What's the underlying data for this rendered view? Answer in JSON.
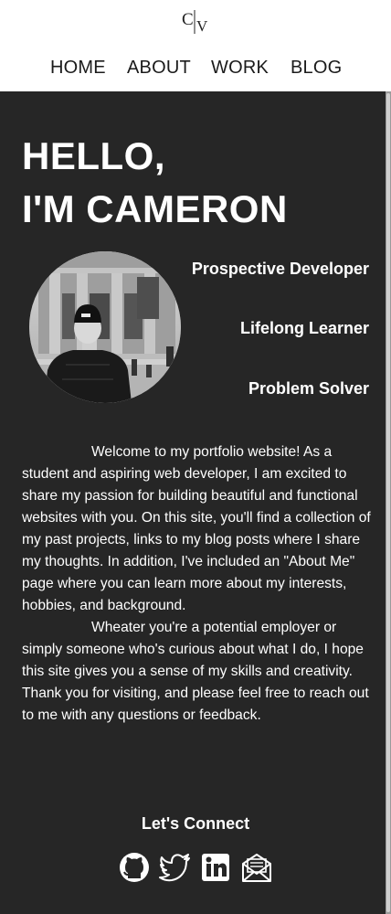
{
  "header": {
    "logo_letters": "CV",
    "nav": [
      {
        "label": "HOME"
      },
      {
        "label": "ABOUT"
      },
      {
        "label": "WORK"
      },
      {
        "label": "BLOG"
      }
    ]
  },
  "hero": {
    "title_line1": "HELLO,",
    "title_line2": "I'M CAMERON",
    "traits": [
      "Prospective Developer",
      "Lifelong Learner",
      "Problem Solver"
    ]
  },
  "intro": {
    "paragraphs": [
      "Welcome to my portfolio website! As a student and aspiring web developer, I am excited to share my passion for building beautiful and functional websites with you. On this site, you'll find a collection of my past projects, links to my blog posts where I share my thoughts. In addition, I've included an \"About Me\" page where you can learn more about my interests, hobbies, and background.",
      "Wheater you're a potential employer or simply someone who's curious about what I do, I hope this site gives you a sense of my skills and creativity. Thank you for visiting, and please feel free to reach out to me with any questions or feedback."
    ]
  },
  "connect": {
    "title": "Let's Connect",
    "icons": [
      "github-icon",
      "twitter-icon",
      "linkedin-icon",
      "email-icon"
    ]
  },
  "colors": {
    "header_bg": "#ffffff",
    "page_bg": "#262626",
    "text": "#ffffff",
    "nav_text": "#1b1b1b"
  }
}
